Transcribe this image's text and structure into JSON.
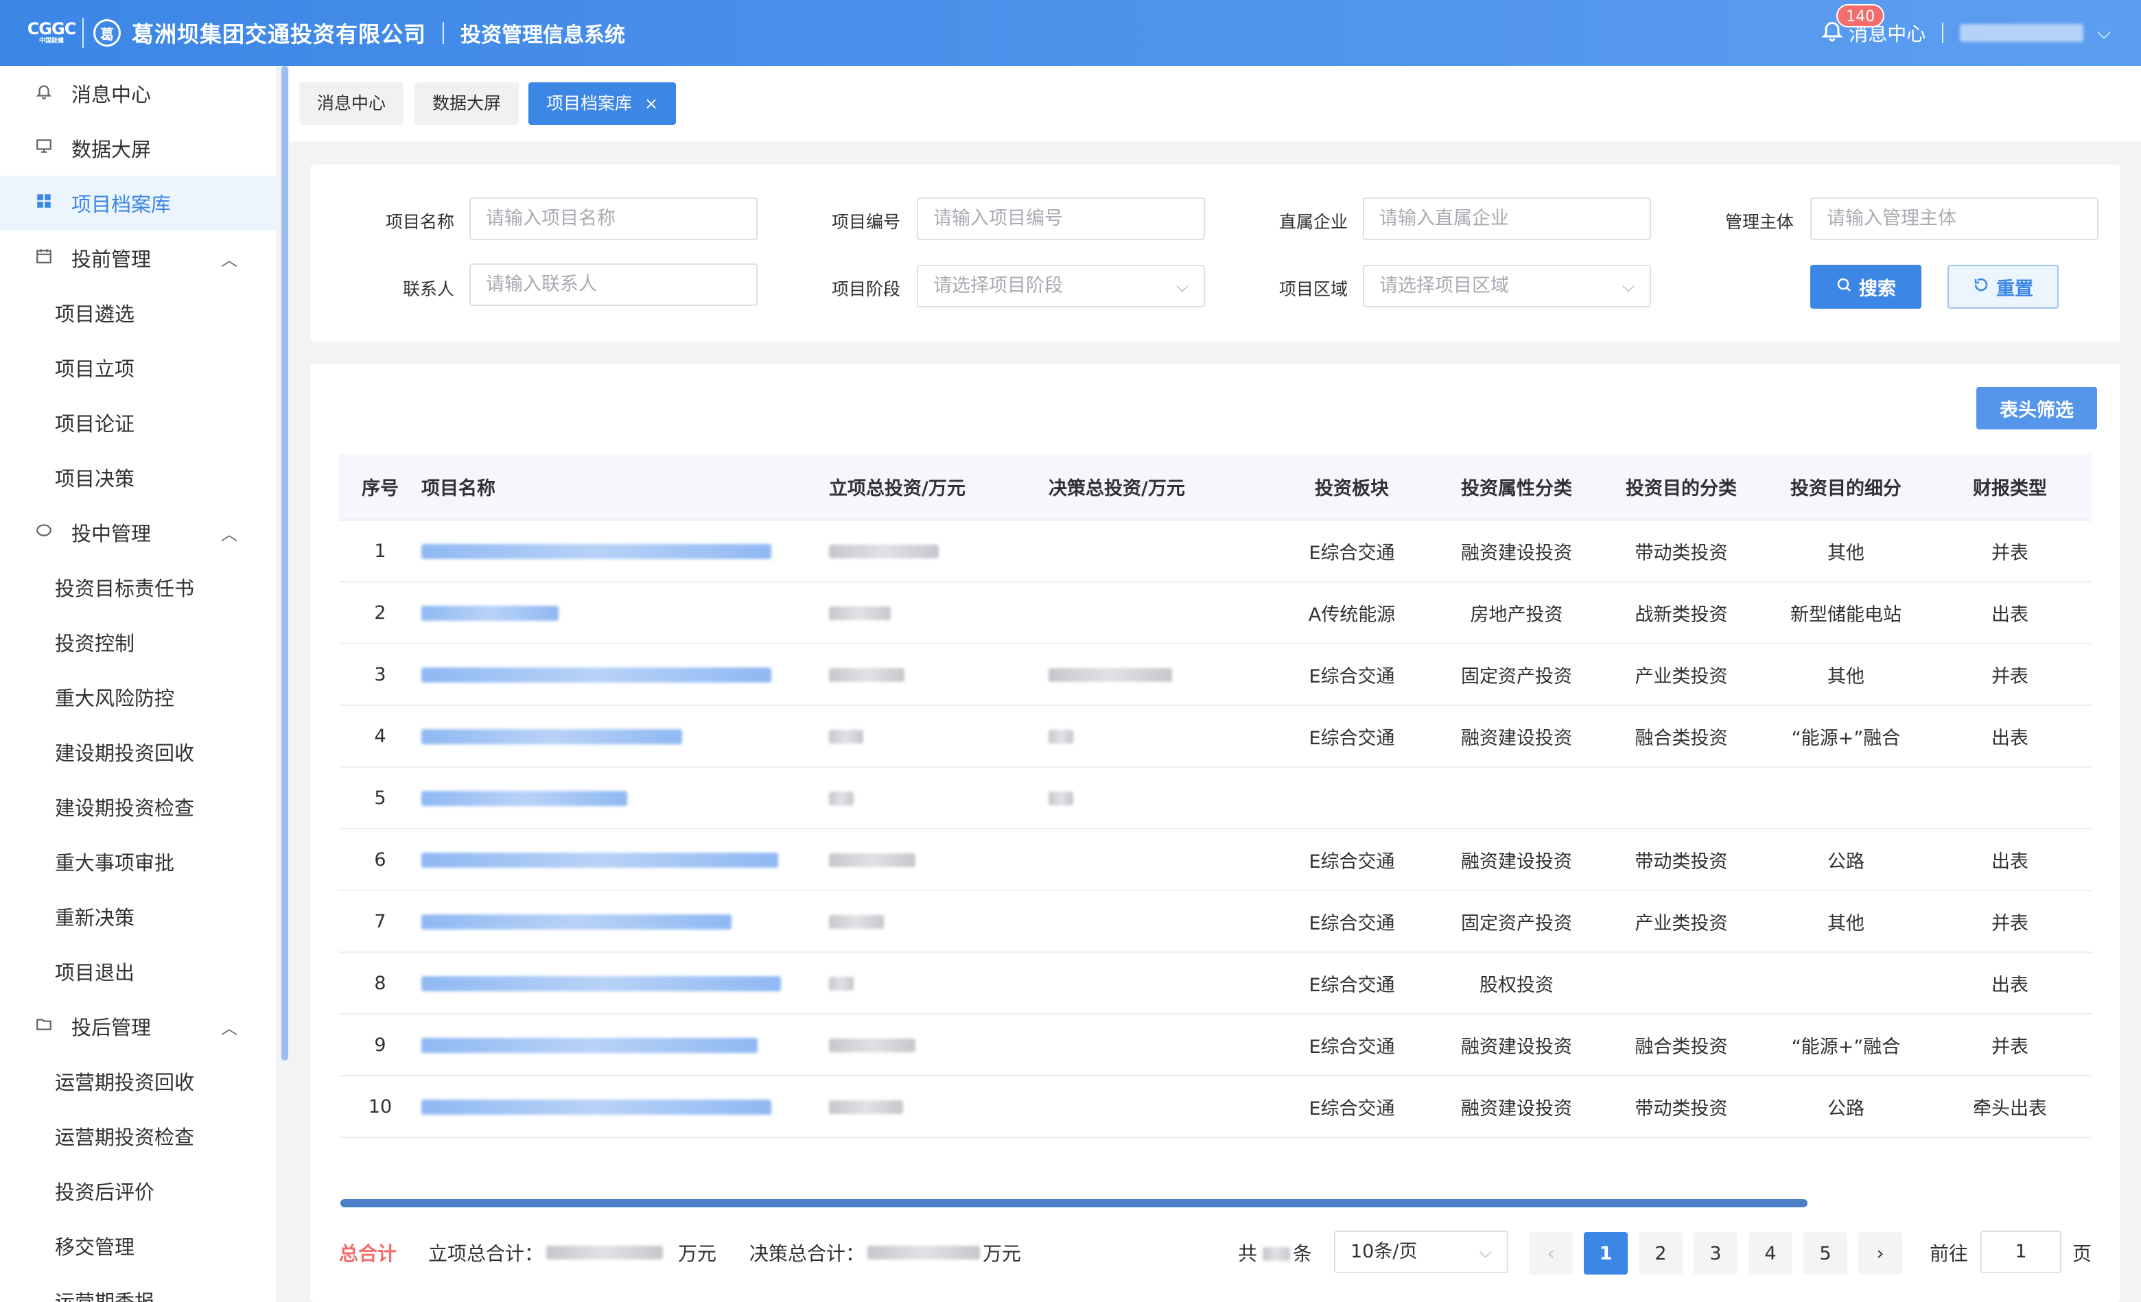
{
  "header": {
    "logo_top": "CGGC",
    "logo_bottom": "中国能建",
    "logo_circle": "葛",
    "company": "葛洲坝集团交通投资有限公司",
    "system": "投资管理信息系统",
    "badge": "140",
    "msg_center": "消息中心"
  },
  "sidebar": {
    "items": [
      {
        "label": "消息中心"
      },
      {
        "label": "数据大屏"
      },
      {
        "label": "项目档案库"
      },
      {
        "label": "投前管理"
      },
      {
        "label": "项目遴选"
      },
      {
        "label": "项目立项"
      },
      {
        "label": "项目论证"
      },
      {
        "label": "项目决策"
      },
      {
        "label": "投中管理"
      },
      {
        "label": "投资目标责任书"
      },
      {
        "label": "投资控制"
      },
      {
        "label": "重大风险防控"
      },
      {
        "label": "建设期投资回收"
      },
      {
        "label": "建设期投资检查"
      },
      {
        "label": "重大事项审批"
      },
      {
        "label": "重新决策"
      },
      {
        "label": "项目退出"
      },
      {
        "label": "投后管理"
      },
      {
        "label": "运营期投资回收"
      },
      {
        "label": "运营期投资检查"
      },
      {
        "label": "投资后评价"
      },
      {
        "label": "移交管理"
      },
      {
        "label": "运营期季报"
      }
    ]
  },
  "tabs": [
    {
      "label": "消息中心"
    },
    {
      "label": "数据大屏"
    },
    {
      "label": "项目档案库"
    }
  ],
  "filter": {
    "project_name_label": "项目名称",
    "project_name_ph": "请输入项目名称",
    "project_no_label": "项目编号",
    "project_no_ph": "请输入项目编号",
    "direct_ent_label": "直属企业",
    "direct_ent_ph": "请输入直属企业",
    "mgmt_label": "管理主体",
    "mgmt_ph": "请输入管理主体",
    "contact_label": "联系人",
    "contact_ph": "请输入联系人",
    "stage_label": "项目阶段",
    "stage_ph": "请选择项目阶段",
    "region_label": "项目区域",
    "region_ph": "请选择项目区域",
    "search": "搜索",
    "reset": "重置"
  },
  "table": {
    "header_filter": "表头筛选",
    "columns": [
      "序号",
      "项目名称",
      "立项总投资/万元",
      "决策总投资/万元",
      "投资板块",
      "投资属性分类",
      "投资目的分类",
      "投资目的细分",
      "财报类型"
    ],
    "rows": [
      {
        "no": "1",
        "sector": "E综合交通",
        "attr": "融资建设投资",
        "purpose": "带动类投资",
        "detail": "其他",
        "report": "并表"
      },
      {
        "no": "2",
        "sector": "A传统能源",
        "attr": "房地产投资",
        "purpose": "战新类投资",
        "detail": "新型储能电站",
        "report": "出表"
      },
      {
        "no": "3",
        "sector": "E综合交通",
        "attr": "固定资产投资",
        "purpose": "产业类投资",
        "detail": "其他",
        "report": "并表"
      },
      {
        "no": "4",
        "sector": "E综合交通",
        "attr": "融资建设投资",
        "purpose": "融合类投资",
        "detail": "“能源+”融合",
        "report": "出表"
      },
      {
        "no": "5",
        "sector": "",
        "attr": "",
        "purpose": "",
        "detail": "",
        "report": ""
      },
      {
        "no": "6",
        "sector": "E综合交通",
        "attr": "融资建设投资",
        "purpose": "带动类投资",
        "detail": "公路",
        "report": "出表"
      },
      {
        "no": "7",
        "sector": "E综合交通",
        "attr": "固定资产投资",
        "purpose": "产业类投资",
        "detail": "其他",
        "report": "并表"
      },
      {
        "no": "8",
        "sector": "E综合交通",
        "attr": "股权投资",
        "purpose": "",
        "detail": "",
        "report": "出表"
      },
      {
        "no": "9",
        "sector": "E综合交通",
        "attr": "融资建设投资",
        "purpose": "融合类投资",
        "detail": "“能源+”融合",
        "report": "并表"
      },
      {
        "no": "10",
        "sector": "E综合交通",
        "attr": "融资建设投资",
        "purpose": "带动类投资",
        "detail": "公路",
        "report": "牵头出表"
      }
    ]
  },
  "footer": {
    "total_label": "总合计",
    "approval_total_label": "立项总合计：",
    "decision_total_label": "决策总合计：",
    "unit": "万元",
    "count_prefix": "共",
    "count_suffix": "条",
    "page_size": "10条/页",
    "pages": [
      "1",
      "2",
      "3",
      "4",
      "5"
    ],
    "goto_label": "前往",
    "goto_value": "1",
    "page_suffix": "页"
  }
}
